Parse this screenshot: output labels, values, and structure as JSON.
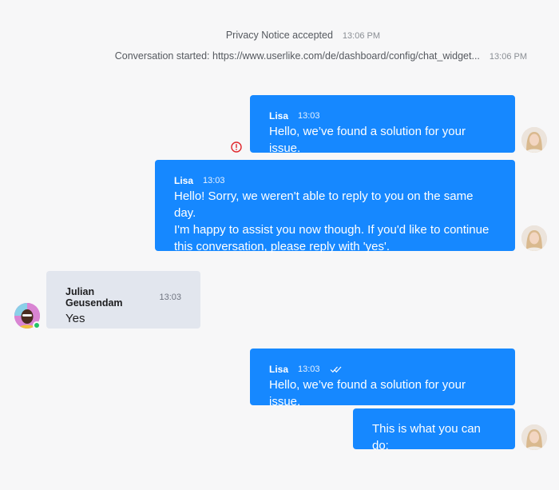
{
  "system": {
    "privacy_text": "Privacy Notice accepted",
    "privacy_time": "13:06 PM",
    "started_text": "Conversation started: https://www.userlike.com/de/dashboard/config/chat_widget...",
    "started_time": "13:06 PM"
  },
  "messages": [
    {
      "sender": "Lisa",
      "time": "13:03",
      "text": "Hello, we’ve found a solution for your issue.",
      "status_icon": "error-icon"
    },
    {
      "sender": "Lisa",
      "time": "13:03",
      "lines": [
        "Hello! Sorry, we weren't able to reply to you on the same day.",
        "I'm happy to assist you now though. If you'd like to continue",
        "this conversation, please reply with 'yes'."
      ]
    },
    {
      "sender": "Julian Geusendam",
      "time": "13:03",
      "text": "Yes",
      "presence": "online"
    },
    {
      "sender": "Lisa",
      "time": "13:03",
      "text": "Hello, we’ve found a solution for your issue.",
      "status_icon": "double-check-icon"
    },
    {
      "text": "This is what you can do:"
    }
  ],
  "colors": {
    "agent_bubble": "#1688ff",
    "visitor_bubble": "#e2e6ee",
    "background": "#f7f7f8",
    "error": "#e0262b",
    "online": "#23c266"
  }
}
